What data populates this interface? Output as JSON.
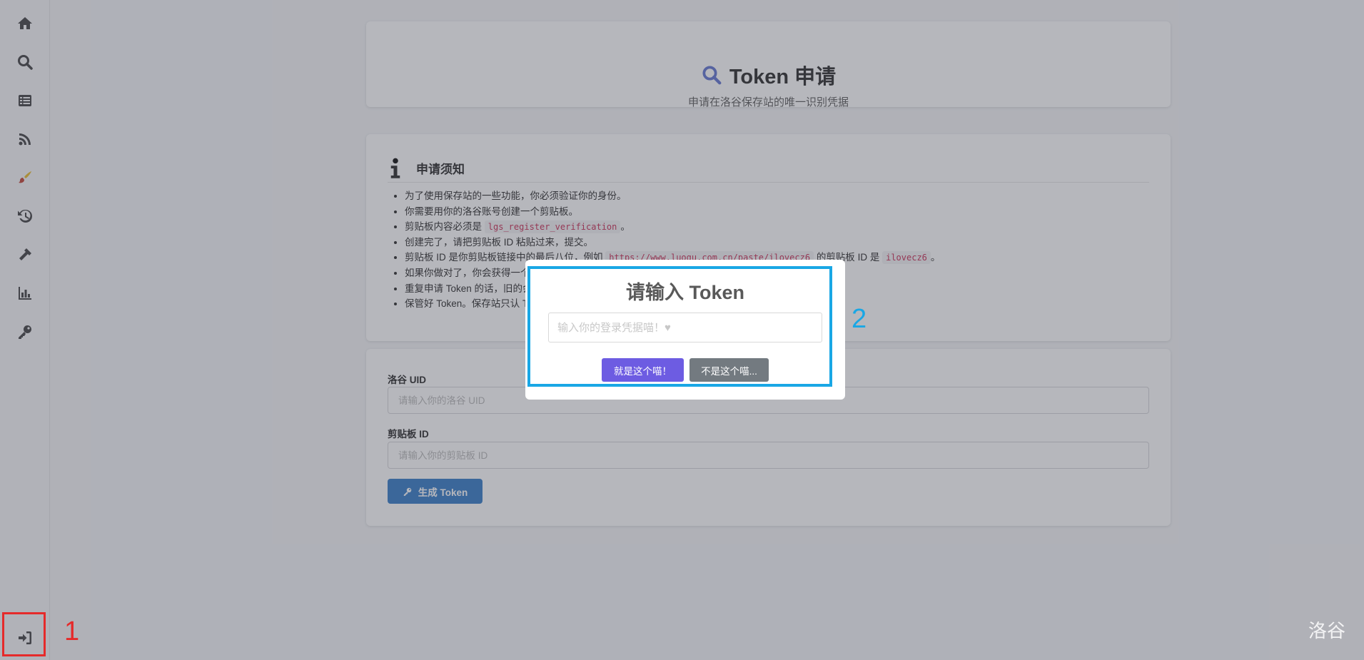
{
  "sidebar": {
    "items": [
      {
        "name": "home-icon"
      },
      {
        "name": "search-icon"
      },
      {
        "name": "list-icon"
      },
      {
        "name": "rss-icon"
      },
      {
        "name": "paint-brush-icon"
      },
      {
        "name": "history-icon"
      },
      {
        "name": "hammer-icon"
      },
      {
        "name": "chart-bar-icon"
      },
      {
        "name": "key-icon"
      }
    ],
    "login_icon": "sign-in-icon"
  },
  "header": {
    "title": "Token 申请",
    "subtitle": "申请在洛谷保存站的唯一识别凭据",
    "icon": "search-icon",
    "icon_color": "#5a6fcf"
  },
  "notice": {
    "title": "申请须知",
    "icon": "info-icon",
    "items": [
      {
        "text": "为了使用保存站的一些功能，你必须验证你的身份。"
      },
      {
        "text": "你需要用你的洛谷账号创建一个剪贴板。"
      },
      {
        "pre": "剪贴板内容必须是",
        "code": "lgs_register_verification",
        "post": "。"
      },
      {
        "text": "创建完了，请把剪贴板 ID 粘贴过来，提交。"
      },
      {
        "pre": "剪贴板 ID 是你剪贴板链接中的最后八位，例如",
        "code": "https://www.luogu.com.cn/paste/ilovecz6",
        "mid": "的剪贴板 ID 是",
        "code2": "ilovecz6",
        "post": "。"
      },
      {
        "text": "如果你做对了，你会获得一个 Token"
      },
      {
        "text": "重复申请 Token 的话，旧的会失效。"
      },
      {
        "text": "保管好 Token。保存站只认 Token 不"
      }
    ]
  },
  "form": {
    "uid_label": "洛谷 UID",
    "uid_placeholder": "请输入你的洛谷 UID",
    "paste_label": "剪贴板 ID",
    "paste_placeholder": "请输入你的剪贴板 ID",
    "submit_label": "生成 Token",
    "submit_color": "#2c75c4"
  },
  "modal": {
    "title": "请输入 Token",
    "input_placeholder": "输入你的登录凭据喵！♥",
    "confirm_label": "就是这个喵！",
    "cancel_label": "不是这个喵...",
    "confirm_color": "#6d5ce2",
    "cancel_color": "#737a80"
  },
  "watermark": "洛谷",
  "annotations": {
    "label_1": "1",
    "label_2": "2",
    "color_1": "#e52a2a",
    "color_2": "#19a7e5"
  }
}
